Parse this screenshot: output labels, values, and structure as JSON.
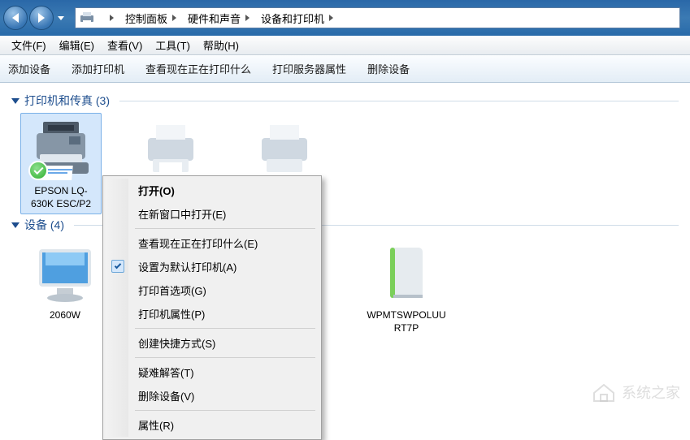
{
  "breadcrumbs": {
    "items": [
      {
        "label": "控制面板"
      },
      {
        "label": "硬件和声音"
      },
      {
        "label": "设备和打印机"
      }
    ]
  },
  "menubar": {
    "file": "文件(F)",
    "edit": "编辑(E)",
    "view": "查看(V)",
    "tools": "工具(T)",
    "help": "帮助(H)"
  },
  "toolbar": {
    "add_device": "添加设备",
    "add_printer": "添加打印机",
    "view_queue": "查看现在正在打印什么",
    "server_properties": "打印服务器属性",
    "remove_device": "删除设备"
  },
  "groups": {
    "printers": {
      "label": "打印机和传真",
      "count": "(3)"
    },
    "devices": {
      "label": "设备",
      "count": "(4)"
    }
  },
  "printers": [
    {
      "name": "EPSON LQ-630K ESC/P2",
      "is_default": true
    },
    {
      "name": ""
    },
    {
      "name": ""
    }
  ],
  "devices": [
    {
      "name": "2060W"
    },
    {
      "name": ""
    },
    {
      "name": ""
    },
    {
      "name": "WPMTSWPOLUURT7P"
    }
  ],
  "context_menu": {
    "open": "打开(O)",
    "open_new_window": "在新窗口中打开(E)",
    "view_queue": "查看现在正在打印什么(E)",
    "set_default": "设置为默认打印机(A)",
    "preferences": "打印首选项(G)",
    "properties_printer": "打印机属性(P)",
    "create_shortcut": "创建快捷方式(S)",
    "troubleshoot": "疑难解答(T)",
    "remove": "删除设备(V)",
    "properties": "属性(R)"
  },
  "watermark": "系统之家"
}
